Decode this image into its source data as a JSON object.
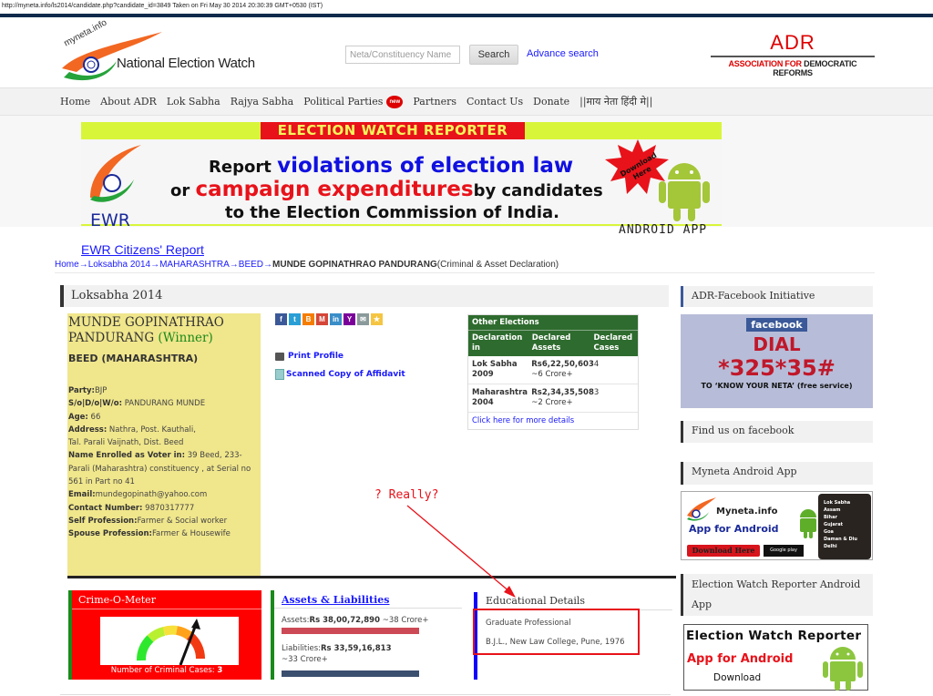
{
  "capture": {
    "text": "http://myneta.info/ls2014/candidate.php?candidate_id=3849 Taken on Fri May 30 2014 20:30:39 GMT+0530 (IST)"
  },
  "header": {
    "logo_tag": "myneta.info",
    "logo_text": "National Election Watch",
    "search_placeholder": "Neta/Constituency Name",
    "search_value": "",
    "search_button": "Search",
    "advance_search": "Advance search",
    "adr_logo": "ADR",
    "adr_full_red": "ASSOCIATION FOR ",
    "adr_full_dark": "DEMOCRATIC REFORMS"
  },
  "nav": {
    "items": [
      {
        "label": "Home"
      },
      {
        "label": "About ADR"
      },
      {
        "label": "Lok Sabha"
      },
      {
        "label": "Rajya Sabha"
      },
      {
        "label": "Political Parties",
        "badge": "new"
      },
      {
        "label": "Partners"
      },
      {
        "label": "Contact Us"
      },
      {
        "label": "Donate"
      },
      {
        "label": "||माय नेता हिंदी मे||"
      }
    ]
  },
  "banner": {
    "title": "ELECTION WATCH REPORTER",
    "line1_prefix": "Report ",
    "line1_highlight": "violations of election law",
    "line2_prefix": "or ",
    "line2_highlight": "campaign expenditures",
    "line2_suffix": "by candidates",
    "line3": "to the Election Commission of India.",
    "ewr": "EWR",
    "starburst": "Download Here",
    "android": "ANDROID APP"
  },
  "ewr_link": "EWR Citizens' Report",
  "breadcrumb": {
    "items": [
      "Home",
      "Loksabha 2014",
      "MAHARASHTRA",
      "BEED"
    ],
    "current": "MUNDE GOPINATHRAO PANDURANG",
    "suffix": "(Criminal & Asset Declaration)",
    "separator": "→"
  },
  "section_title": "Loksabha 2014",
  "candidate": {
    "name": "MUNDE GOPINATHRAO PANDURANG",
    "status": "(Winner)",
    "constituency": "BEED (MAHARASHTRA)",
    "fields": [
      {
        "label": "Party:",
        "value": "BJP"
      },
      {
        "label": "S/o|D/o|W/o:",
        "value": " PANDURANG MUNDE"
      },
      {
        "label": "Age:",
        "value": " 66"
      },
      {
        "label": "Address:",
        "value": " Nathra, Post. Kauthali, Tal. Parali Vaijnath, Dist. Beed"
      },
      {
        "label": "Name Enrolled as Voter in:",
        "value": " 39 Beed, 233-Parali (Maharashtra) constituency , at Serial no 561 in Part no 41"
      },
      {
        "label": "Email:",
        "value": "mundegopinath@yahoo.com"
      },
      {
        "label": "Contact Number:",
        "value": " 9870317777"
      },
      {
        "label": "Self Profession:",
        "value": "Farmer & Social worker"
      },
      {
        "label": "Spouse Profession:",
        "value": "Farmer & Housewife"
      }
    ]
  },
  "share": {
    "icons": [
      {
        "name": "facebook-icon",
        "glyph": "f",
        "color": "#3b5998"
      },
      {
        "name": "twitter-icon",
        "glyph": "t",
        "color": "#2a9fd6"
      },
      {
        "name": "blogger-icon",
        "glyph": "B",
        "color": "#f57d00"
      },
      {
        "name": "gmail-icon",
        "glyph": "M",
        "color": "#d44638"
      },
      {
        "name": "linkedin-icon",
        "glyph": "in",
        "color": "#3a8ec8"
      },
      {
        "name": "yahoo-mail-icon",
        "glyph": "Y",
        "color": "#7b0099"
      },
      {
        "name": "email-icon",
        "glyph": "✉",
        "color": "#8a9a9a"
      },
      {
        "name": "favorite-icon",
        "glyph": "★",
        "color": "#f5c542"
      }
    ]
  },
  "links": {
    "print": "Print Profile",
    "affidavit": "Scanned Copy of Affidavit"
  },
  "other_elections": {
    "title": "Other Elections",
    "headers": [
      "Declaration in",
      "Declared Assets",
      "Declared Cases"
    ],
    "rows": [
      {
        "election": "Lok Sabha 2009",
        "assets": "Rs6,22,50,603",
        "approx": "~6 Crore+",
        "cases": "4"
      },
      {
        "election": "Maharashtra 2004",
        "assets": "Rs2,34,35,508",
        "approx": "~2 Crore+",
        "cases": "3"
      }
    ],
    "more": "Click here for more details"
  },
  "annotation": {
    "text": "? Really?",
    "color": "#e8121a"
  },
  "crime": {
    "title": "Crime-O-Meter",
    "count_label": "Number of Criminal Cases: ",
    "count": "3"
  },
  "assets": {
    "title": "Assets & Liabilities",
    "assets_label": "Assets:",
    "assets_value": "Rs 38,00,72,890",
    "assets_approx": " ~38 Crore+",
    "liabilities_label": "Liabilities:",
    "liabilities_value": "Rs 33,59,16,813",
    "liabilities_approx": "~33 Crore+",
    "assets_color": "#cc4a55",
    "liabilities_color": "#3b4f6e"
  },
  "education": {
    "title": "Educational Details",
    "category": "Graduate Professional",
    "detail": "B.J.L., New Law College, Pune, 1976"
  },
  "sidebar": {
    "fb_head": "ADR-Facebook Initiative",
    "fb_logo": "facebook",
    "fb_dial": "DIAL",
    "fb_number": "*325*35#",
    "fb_sub": "TO ‘KNOW YOUR NETA’ (free service)",
    "find_fb": "Find us on facebook",
    "app_head": "Myneta Android App",
    "app_name": "Myneta.info",
    "app_for": "App for Android",
    "app_download": "Download Here",
    "app_store": "Google play",
    "app_states": [
      "Lok Sabha",
      "Assam",
      "Bihar",
      "Gujarat",
      "Goa",
      "Daman & Diu",
      "Delhi"
    ],
    "ewr_head": "Election Watch Reporter Android App",
    "ewr_t1": "Election Watch Reporter",
    "ewr_t2": "App for Android",
    "ewr_t3": "Download"
  }
}
